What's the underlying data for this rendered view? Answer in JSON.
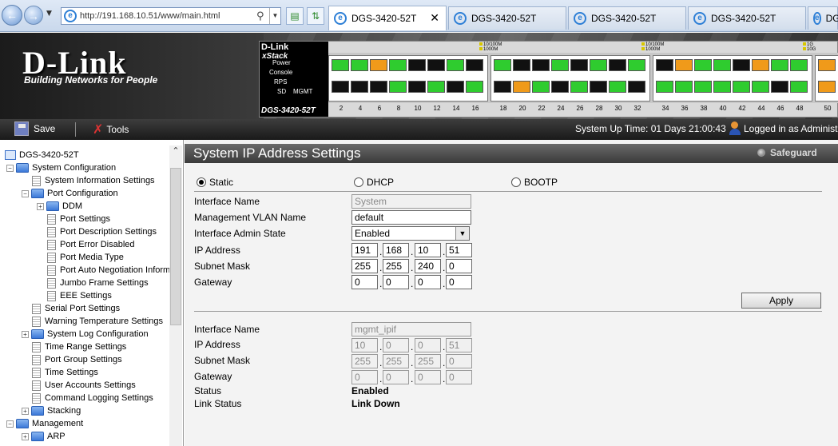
{
  "browser": {
    "url": "http://191.168.10.51/www/main.html",
    "tabs": [
      "DGS-3420-52T",
      "DGS-3420-52T",
      "DGS-3420-52T",
      "DGS-3420-52T",
      "DGS"
    ]
  },
  "banner": {
    "logo": "D-Link",
    "tagline": "Building Networks for People",
    "device_brand": "D-Link",
    "xstack": "xStack",
    "leds": [
      "Power",
      "Console",
      "RPS",
      "SD",
      "MGMT"
    ],
    "model": "DGS-3420-52T",
    "speed_labels": [
      "10/100M",
      "1000M",
      "1G",
      "10G"
    ],
    "port_numbers": [
      "2",
      "4",
      "6",
      "8",
      "10",
      "12",
      "14",
      "16",
      "18",
      "20",
      "22",
      "24",
      "26",
      "28",
      "30",
      "32",
      "34",
      "36",
      "38",
      "40",
      "42",
      "44",
      "46",
      "48",
      "50"
    ]
  },
  "toolbar": {
    "save_label": "Save",
    "tools_label": "Tools",
    "uptime": "System Up Time: 01 Days 21:00:43",
    "login": "Logged in as Administ"
  },
  "tree": {
    "root": "DGS-3420-52T",
    "items": [
      {
        "label": "System Configuration",
        "type": "folder",
        "expanded": true
      },
      {
        "label": "System Information Settings",
        "type": "page"
      },
      {
        "label": "Port Configuration",
        "type": "folder",
        "expanded": true
      },
      {
        "label": "DDM",
        "type": "folder",
        "expanded": false
      },
      {
        "label": "Port Settings",
        "type": "page"
      },
      {
        "label": "Port Description Settings",
        "type": "page"
      },
      {
        "label": "Port Error Disabled",
        "type": "page"
      },
      {
        "label": "Port Media Type",
        "type": "page"
      },
      {
        "label": "Port Auto Negotiation Inform",
        "type": "page"
      },
      {
        "label": "Jumbo Frame Settings",
        "type": "page"
      },
      {
        "label": "EEE Settings",
        "type": "page"
      },
      {
        "label": "Serial Port Settings",
        "type": "page"
      },
      {
        "label": "Warning Temperature Settings",
        "type": "page"
      },
      {
        "label": "System Log Configuration",
        "type": "folder",
        "expanded": false
      },
      {
        "label": "Time Range Settings",
        "type": "page"
      },
      {
        "label": "Port Group Settings",
        "type": "page"
      },
      {
        "label": "Time Settings",
        "type": "page"
      },
      {
        "label": "User Accounts Settings",
        "type": "page"
      },
      {
        "label": "Command Logging Settings",
        "type": "page"
      },
      {
        "label": "Stacking",
        "type": "folder",
        "expanded": false
      },
      {
        "label": "Management",
        "type": "folder",
        "expanded": true
      },
      {
        "label": "ARP",
        "type": "folder",
        "expanded": false
      }
    ]
  },
  "main": {
    "title": "System IP Address Settings",
    "safeguard": "Safeguard",
    "modes": {
      "static": "Static",
      "dhcp": "DHCP",
      "bootp": "BOOTP",
      "selected": "Static"
    },
    "system_if": {
      "labels": {
        "interface_name": "Interface Name",
        "mgmt_vlan": "Management VLAN Name",
        "admin_state": "Interface Admin State",
        "ip": "IP Address",
        "mask": "Subnet Mask",
        "gateway": "Gateway"
      },
      "interface_name": "System",
      "mgmt_vlan": "default",
      "admin_state": "Enabled",
      "ip": [
        "191",
        "168",
        "10",
        "51"
      ],
      "mask": [
        "255",
        "255",
        "240",
        "0"
      ],
      "gateway": [
        "0",
        "0",
        "0",
        "0"
      ]
    },
    "apply_label": "Apply",
    "mgmt_if": {
      "labels": {
        "interface_name": "Interface Name",
        "ip": "IP Address",
        "mask": "Subnet Mask",
        "gateway": "Gateway",
        "status": "Status",
        "link_status": "Link Status"
      },
      "interface_name": "mgmt_ipif",
      "ip": [
        "10",
        "0",
        "0",
        "51"
      ],
      "mask": [
        "255",
        "255",
        "255",
        "0"
      ],
      "gateway": [
        "0",
        "0",
        "0",
        "0"
      ],
      "status": "Enabled",
      "link_status": "Link Down"
    }
  }
}
